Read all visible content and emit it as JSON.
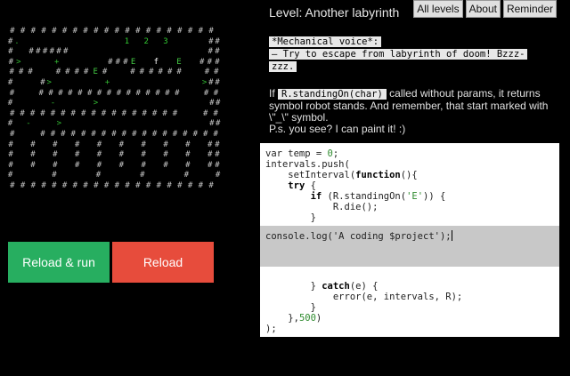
{
  "maze": {
    "rows": [
      "# # # # # # # # # # # # # # # # # # # #",
      "# .                 1   2   3       # #",
      "#   # # # # # #                     # #",
      "# >     +       # # # E   f   E   # # #",
      "# # #   # # # # E #   # # # # # #   # #",
      "#     # >         +               > # #",
      "#   # # # # # # # # # # # # # # #   # #",
      "#       -       >                   # #",
      "# # # # # # # # # # # # # # # # #   # #",
      "#   -     >                         # #",
      "#   # # # # # # # # # # # # # # # # # #",
      "#   #   #   #   #   #   #   #   #   # #",
      "#   #   #   #   #   #   #   #   #   # #",
      "#   #   #   #   #   #   #   #   #   # #",
      "#       #       #       #       #     #",
      "# # # # # # # # # # # # # # # # # # # #"
    ]
  },
  "buttons": {
    "run": "Reload & run",
    "reload": "Reload"
  },
  "header": {
    "level_label": "Level: Another labyrinth"
  },
  "nav": {
    "all_levels": "All levels",
    "about": "About",
    "reminder": "Reminder"
  },
  "speech": {
    "speaker": "*Mechanical voice*:",
    "line1": "— Try to escape from labyrinth of doom! Bzzz-",
    "line2": "zzz."
  },
  "hint": {
    "prefix": "If",
    "code": "R.standingOn(char)",
    "text1": "called without params, it returns symbol robot stands. And remember, that start marked with \\\"_\\\" symbol.",
    "text2": "P.s. you see? I can paint it! :)"
  },
  "editor": {
    "head": [
      "var temp = 0;",
      "intervals.push(",
      "    setInterval(function(){",
      "    try {",
      "        if (R.standingOn('E')) {",
      "            R.die();",
      "        }"
    ],
    "user_code": "console.log('A coding $project');",
    "tail": [
      "        } catch(e) {",
      "            error(e, intervals, R);",
      "        }",
      "    },500)",
      ");"
    ]
  }
}
